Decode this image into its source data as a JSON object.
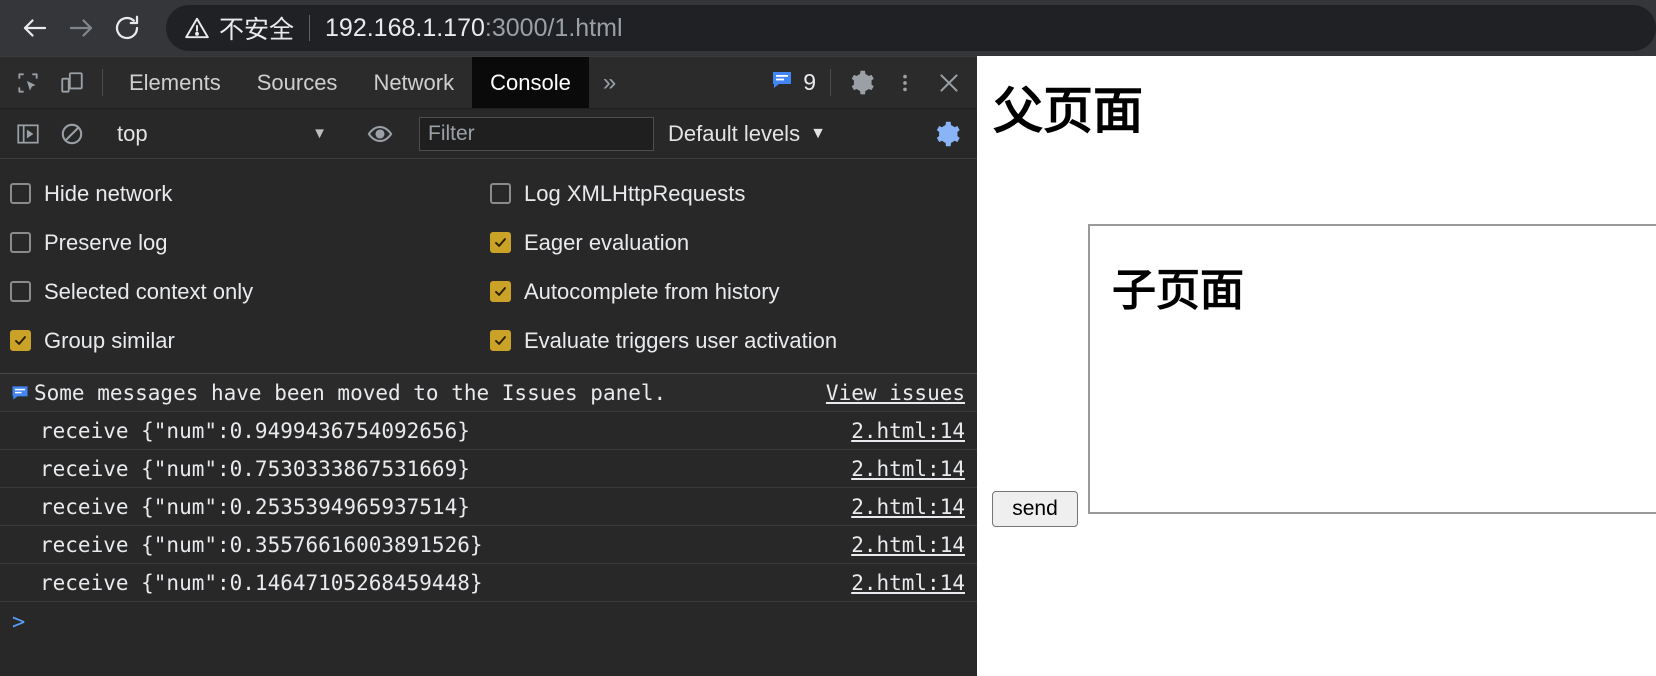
{
  "browser": {
    "back_icon": "arrow-left-icon",
    "forward_icon": "arrow-right-icon",
    "reload_icon": "reload-icon",
    "security_warning_icon": "warning-triangle-icon",
    "security_label": "不安全",
    "url_host": "192.168.1.170",
    "url_path": ":3000/1.html"
  },
  "devtools": {
    "inspect_icon": "inspect-element-icon",
    "device_toolbar_icon": "device-toolbar-icon",
    "tabs": [
      {
        "label": "Elements",
        "active": false
      },
      {
        "label": "Sources",
        "active": false
      },
      {
        "label": "Network",
        "active": false
      },
      {
        "label": "Console",
        "active": true
      }
    ],
    "more_tabs_label": "»",
    "issues_icon": "issues-message-icon",
    "issues_count": "9",
    "settings_icon": "gear-icon",
    "more_options_icon": "kebab-menu-icon",
    "close_icon": "close-icon",
    "console_toolbar": {
      "sidebar_toggle_icon": "console-sidebar-icon",
      "clear_console_icon": "clear-console-icon",
      "context_value": "top",
      "context_caret": "▼",
      "live_expression_icon": "eye-icon",
      "filter_placeholder": "Filter",
      "filter_value": "",
      "levels_value": "Default levels",
      "levels_caret": "▼",
      "settings_gear_icon": "gear-icon"
    },
    "settings": [
      {
        "label": "Hide network",
        "checked": false,
        "label2": "Log XMLHttpRequests",
        "checked2": false
      },
      {
        "label": "Preserve log",
        "checked": false,
        "label2": "Eager evaluation",
        "checked2": true
      },
      {
        "label": "Selected context only",
        "checked": false,
        "label2": "Autocomplete from history",
        "checked2": true
      },
      {
        "label": "Group similar",
        "checked": true,
        "label2": "Evaluate triggers user activation",
        "checked2": true
      }
    ],
    "messages": [
      {
        "kind": "issue",
        "icon": "issues-message-icon",
        "text": "Some messages have been moved to the Issues panel.",
        "link": "View issues"
      },
      {
        "kind": "log",
        "text": "receive {\"num\":0.9499436754092656}",
        "link": "2.html:14"
      },
      {
        "kind": "log",
        "text": "receive {\"num\":0.7530333867531669}",
        "link": "2.html:14"
      },
      {
        "kind": "log",
        "text": "receive {\"num\":0.2535394965937514}",
        "link": "2.html:14"
      },
      {
        "kind": "log",
        "text": "receive {\"num\":0.35576616003891526}",
        "link": "2.html:14"
      },
      {
        "kind": "log",
        "text": "receive {\"num\":0.14647105268459448}",
        "link": "2.html:14"
      }
    ],
    "prompt_symbol": ">"
  },
  "page": {
    "title": "父页面",
    "iframe_title": "子页面",
    "send_button": "send"
  },
  "colors": {
    "checkbox_checked": "#c9a227",
    "link_blue": "#5a9cf8",
    "devtools_bg": "#282828",
    "browser_bar_bg": "#35363a"
  }
}
